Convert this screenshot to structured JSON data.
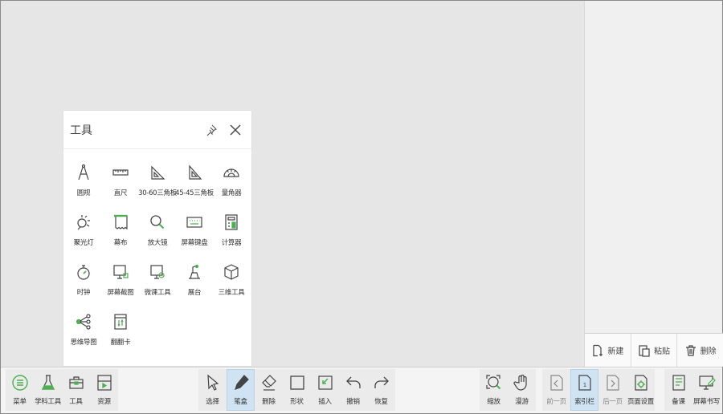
{
  "tools_panel": {
    "title": "工具",
    "tools": [
      {
        "label": "圆规",
        "icon": "compass-icon"
      },
      {
        "label": "直尺",
        "icon": "ruler-icon"
      },
      {
        "label": "30-60三角板",
        "icon": "triangle-30-60-icon"
      },
      {
        "label": "45-45三角板",
        "icon": "triangle-45-45-icon"
      },
      {
        "label": "量角器",
        "icon": "protractor-icon"
      },
      {
        "label": "聚光灯",
        "icon": "spotlight-icon"
      },
      {
        "label": "幕布",
        "icon": "curtain-icon"
      },
      {
        "label": "放大镜",
        "icon": "magnifier-icon"
      },
      {
        "label": "屏幕键盘",
        "icon": "keyboard-icon"
      },
      {
        "label": "计算器",
        "icon": "calculator-icon"
      },
      {
        "label": "时钟",
        "icon": "stopwatch-icon"
      },
      {
        "label": "屏幕截图",
        "icon": "screenshot-icon"
      },
      {
        "label": "微课工具",
        "icon": "micro-lesson-icon"
      },
      {
        "label": "展台",
        "icon": "document-camera-icon"
      },
      {
        "label": "三维工具",
        "icon": "cube-icon"
      },
      {
        "label": "思维导图",
        "icon": "mind-map-icon"
      },
      {
        "label": "翻翻卡",
        "icon": "flip-card-icon"
      }
    ]
  },
  "side_panel": {
    "actions": [
      {
        "label": "新建",
        "icon": "new-page-icon"
      },
      {
        "label": "粘贴",
        "icon": "paste-icon"
      },
      {
        "label": "删除",
        "icon": "trash-icon"
      }
    ]
  },
  "toolbar": {
    "left": [
      {
        "label": "菜单",
        "icon": "menu-icon"
      },
      {
        "label": "学科工具",
        "icon": "flask-icon"
      },
      {
        "label": "工具",
        "icon": "toolbox-icon"
      },
      {
        "label": "资源",
        "icon": "resource-icon"
      }
    ],
    "center": [
      {
        "label": "选择",
        "icon": "cursor-icon"
      },
      {
        "label": "笔盒",
        "icon": "pen-icon"
      },
      {
        "label": "删除",
        "icon": "eraser-icon"
      },
      {
        "label": "形状",
        "icon": "shape-icon"
      },
      {
        "label": "插入",
        "icon": "insert-icon"
      },
      {
        "label": "撤销",
        "icon": "undo-icon"
      },
      {
        "label": "恢复",
        "icon": "redo-icon"
      }
    ],
    "right_a": [
      {
        "label": "缩放",
        "icon": "zoom-icon"
      },
      {
        "label": "漫游",
        "icon": "hand-icon"
      }
    ],
    "right_b": [
      {
        "label": "前一页",
        "icon": "prev-page-icon"
      },
      {
        "label": "索引栏",
        "icon": "index-icon",
        "page_number": "1"
      },
      {
        "label": "后一页",
        "icon": "next-page-icon"
      },
      {
        "label": "页面设置",
        "icon": "page-settings-icon"
      }
    ],
    "right_c": [
      {
        "label": "备课",
        "icon": "lesson-prep-icon"
      },
      {
        "label": "屏幕书写",
        "icon": "screen-write-icon"
      }
    ]
  },
  "colors": {
    "accent_green": "#4caf50",
    "active_bg": "#cfe3f2",
    "icon_stroke": "#444444"
  }
}
